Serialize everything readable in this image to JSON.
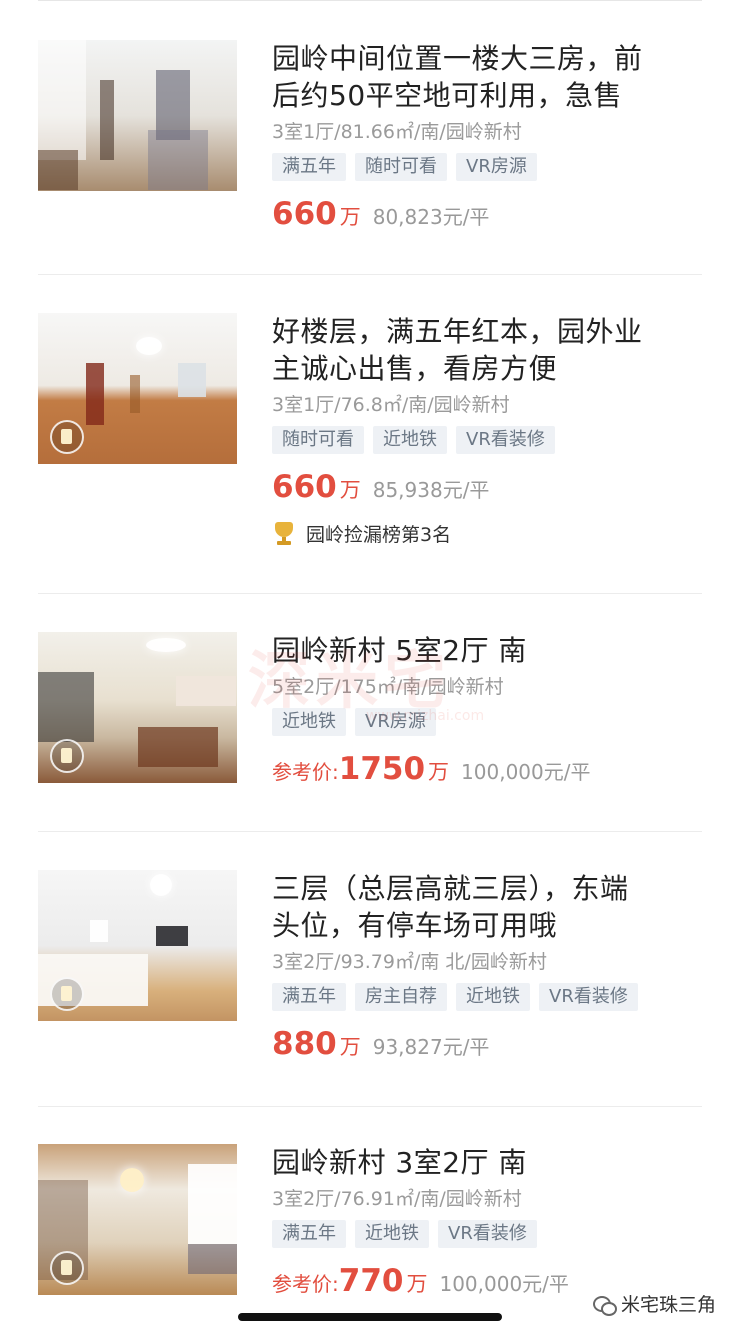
{
  "listings": [
    {
      "title_line1": "园岭中间位置一楼大三房，前",
      "title_line2": "后约50平空地可利用，急售",
      "specs": "3室1厅/81.66㎡/南/园岭新村",
      "tags": [
        "满五年",
        "随时可看",
        "VR房源"
      ],
      "price_prefix": "",
      "price": "660",
      "price_unit": "万",
      "unit_price": "80,823元/平"
    },
    {
      "title_line1": "好楼层，满五年红本，园外业",
      "title_line2": "主诚心出售，看房方便",
      "specs": "3室1厅/76.8㎡/南/园岭新村",
      "tags": [
        "随时可看",
        "近地铁",
        "VR看装修"
      ],
      "price_prefix": "",
      "price": "660",
      "price_unit": "万",
      "unit_price": "85,938元/平",
      "rank": "园岭捡漏榜第3名"
    },
    {
      "title_line1": "园岭新村 5室2厅 南",
      "title_line2": "",
      "specs": "5室2厅/175㎡/南/园岭新村",
      "tags": [
        "近地铁",
        "VR房源"
      ],
      "price_prefix": "参考价:",
      "price": "1750",
      "price_unit": "万",
      "unit_price": "100,000元/平"
    },
    {
      "title_line1": "三层（总层高就三层），东端",
      "title_line2": "头位，有停车场可用哦",
      "specs": "3室2厅/93.79㎡/南 北/园岭新村",
      "tags": [
        "满五年",
        "房主自荐",
        "近地铁",
        "VR看装修"
      ],
      "price_prefix": "",
      "price": "880",
      "price_unit": "万",
      "unit_price": "93,827元/平"
    },
    {
      "title_line1": "园岭新村 3室2厅 南",
      "title_line2": "",
      "specs": "3室2厅/76.91㎡/南/园岭新村",
      "tags": [
        "满五年",
        "近地铁",
        "VR看装修"
      ],
      "price_prefix": "参考价:",
      "price": "770",
      "price_unit": "万",
      "unit_price": "100,000元/平"
    }
  ],
  "watermark": {
    "text": "深米宅",
    "url": "www.mizhai.com"
  },
  "account_name": "米宅珠三角",
  "colors": {
    "price": "#e24e3f",
    "tag_bg": "#eef1f5",
    "tag_text": "#6b7785",
    "title": "#222222",
    "meta": "#9a9a9a"
  }
}
